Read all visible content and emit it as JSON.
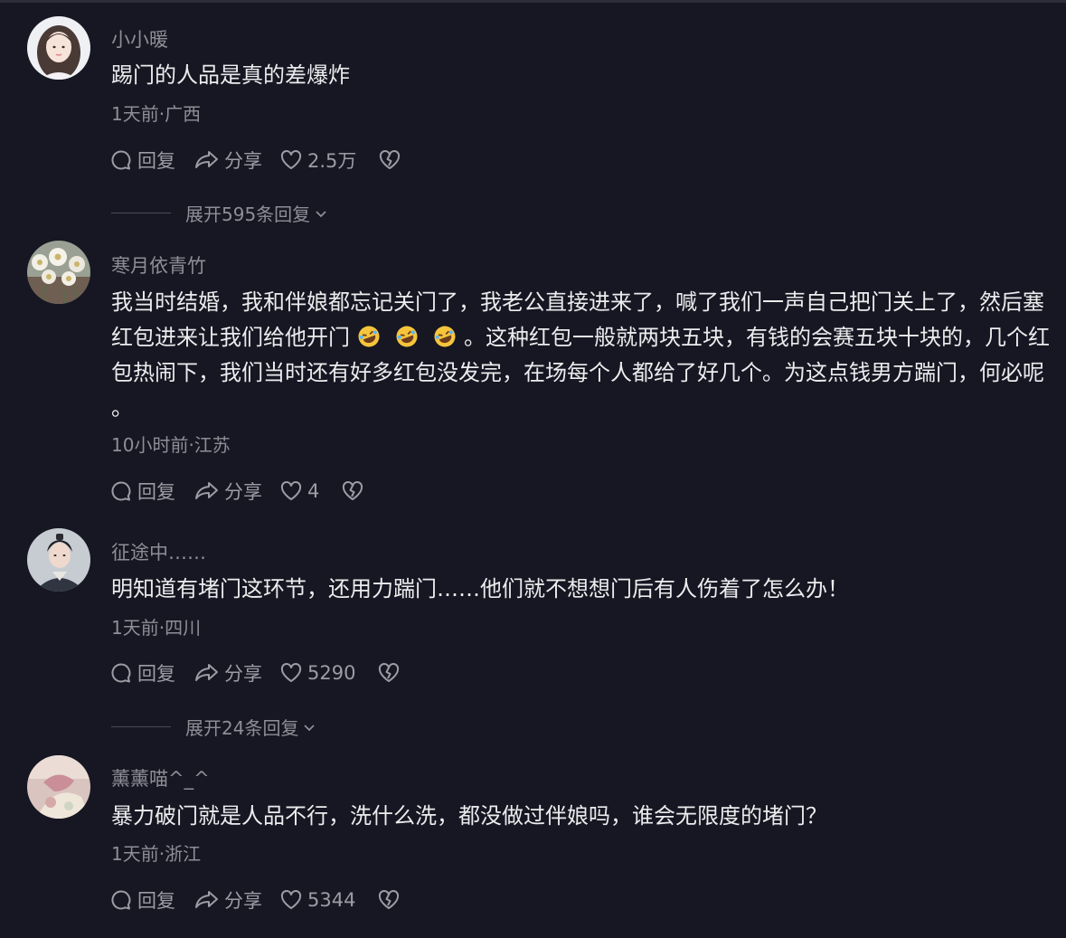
{
  "theme": {
    "background": "#161722",
    "username_color": "#8d8e96",
    "text_color": "#ececee"
  },
  "comments": [
    {
      "username": "小小暖",
      "text": "踢门的人品是真的差爆炸",
      "meta": "1天前·广西",
      "reply_label": "回复",
      "share_label": "分享",
      "likes": "2.5万",
      "expand_label": "展开595条回复",
      "avatar_icon": "girl-portrait-avatar"
    },
    {
      "username": "寒月依青竹",
      "text_part1": "我当时结婚，我和伴娘都忘记关门了，我老公直接进来了，喊了我们一声自己把门关上了，然后塞红包进来让我们给他开门",
      "text_part2": "。这种红包一般就两块五块，有钱的会赛五块十块的，几个红包热闹下，我们当时还有好多红包没发完，在场每个人都给了好几个。为这点钱男方踹门，何必呢 。",
      "meta": "10小时前·江苏",
      "reply_label": "回复",
      "share_label": "分享",
      "likes": "4",
      "avatar_icon": "flowers-avatar",
      "emoji_icon": "rolling-laughing-emoji"
    },
    {
      "username": "征途中……",
      "text": "明知道有堵门这环节，还用力踹门……他们就不想想门后有人伤着了怎么办！",
      "meta": "1天前·四川",
      "reply_label": "回复",
      "share_label": "分享",
      "likes": "5290",
      "expand_label": "展开24条回复",
      "avatar_icon": "costume-man-avatar"
    },
    {
      "username": "薰薰喵^_^",
      "text": "暴力破门就是人品不行，洗什么洗，都没做过伴娘吗，谁会无限度的堵门？",
      "meta": "1天前·浙江",
      "reply_label": "回复",
      "share_label": "分享",
      "likes": "5344",
      "avatar_icon": "pink-photo-avatar"
    }
  ]
}
